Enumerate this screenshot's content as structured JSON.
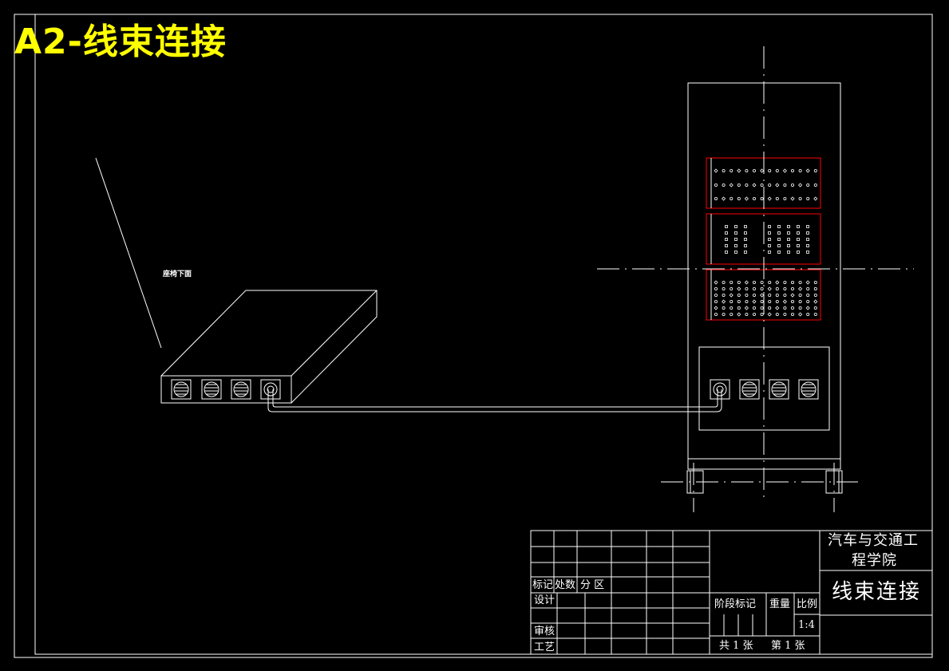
{
  "drawing": {
    "title": "A2-线束连接",
    "note": "座椅下面",
    "title_color": "#ffff00",
    "line_color": "#ffffff",
    "highlight_color": "#ff0000",
    "background_color": "#000000"
  },
  "title_block": {
    "institution_line1": "汽车与交通工",
    "institution_line2": "程学院",
    "drawing_name": "线束连接",
    "revision_header": {
      "mark": "标记",
      "count": "处数",
      "zone": "分 区"
    },
    "design": "设计",
    "review": "审核",
    "process": "工艺",
    "stage_mark": "阶段标记",
    "weight": "重量",
    "scale_label": "比例",
    "scale_value": "1:4",
    "sheets_total": "共 1 张",
    "sheet_number": "第 1 张"
  }
}
